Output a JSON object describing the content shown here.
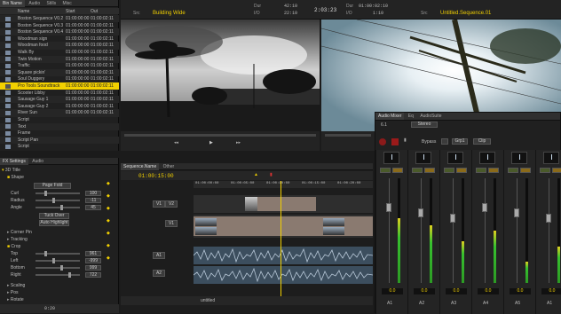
{
  "bin": {
    "tabs": [
      "Bin Name",
      "Audio",
      "Stills",
      "Misc"
    ],
    "columns": {
      "name": "Name",
      "in": "Start",
      "out": "Out"
    },
    "rows": [
      {
        "name": "Boston Sequence V0.2",
        "in": "01:00:00:00",
        "out": "01:00:02:11"
      },
      {
        "name": "Boston Sequence V0.3",
        "in": "01:00:00:00",
        "out": "01:00:02:11"
      },
      {
        "name": "Boston Sequence V0.4",
        "in": "01:00:00:00",
        "out": "01:00:02:11"
      },
      {
        "name": "Woodman sign",
        "in": "01:00:00:00",
        "out": "01:00:02:11"
      },
      {
        "name": "Woodman food",
        "in": "01:00:00:00",
        "out": "01:00:02:11"
      },
      {
        "name": "Walk By",
        "in": "01:00:00:00",
        "out": "01:00:02:11"
      },
      {
        "name": "Twin Motion",
        "in": "01:00:00:00",
        "out": "01:00:02:11"
      },
      {
        "name": "Traffic",
        "in": "01:00:00:00",
        "out": "01:00:02:11"
      },
      {
        "name": "Square pickin'",
        "in": "01:00:00:00",
        "out": "01:00:02:11"
      },
      {
        "name": "Soul Duggery",
        "in": "01:00:00:00",
        "out": "01:00:02:11"
      },
      {
        "name": "Pro Tools Soundtrack",
        "in": "01:00:00:00",
        "out": "01:00:02:11"
      },
      {
        "name": "Scooter Libby",
        "in": "01:00:00:00",
        "out": "01:00:02:11"
      },
      {
        "name": "Sausage Guy 1",
        "in": "01:00:00:00",
        "out": "01:00:02:11"
      },
      {
        "name": "Sausage Guy 2",
        "in": "01:00:00:00",
        "out": "01:00:02:11"
      },
      {
        "name": "River Sun",
        "in": "01:00:00:00",
        "out": "01:00:02:11"
      },
      {
        "name": "Script",
        "in": "",
        "out": ""
      },
      {
        "name": "Text",
        "in": "",
        "out": ""
      },
      {
        "name": "Frame",
        "in": "",
        "out": ""
      },
      {
        "name": "Script Pan",
        "in": "",
        "out": ""
      },
      {
        "name": "Script",
        "in": "",
        "out": ""
      }
    ]
  },
  "fx": {
    "tabs": [
      "FX Settings",
      "Audio"
    ],
    "title": "3D Title",
    "group_shape": "Shape",
    "dropdown": "Page Fold",
    "params": [
      {
        "label": "Curl",
        "value": "100"
      },
      {
        "label": "Radius",
        "value": "-11"
      },
      {
        "label": "Angle",
        "value": "45"
      }
    ],
    "tuck_over": "Tuck Over",
    "auto_highlight": "Auto Highlight",
    "group_corner": "Corner Pin",
    "group_tracking": "Tracking",
    "group_crop": "Crop",
    "crop": [
      {
        "label": "Top",
        "value": "961"
      },
      {
        "label": "Left",
        "value": "-999"
      },
      {
        "label": "Bottom",
        "value": "999"
      },
      {
        "label": "Right",
        "value": "722"
      }
    ],
    "group_scaling": "Scaling",
    "group_pos": "Pos",
    "group_rotate": "Rotate",
    "timecode": "0:20"
  },
  "source": {
    "label": "Src",
    "clip": "Building Wide"
  },
  "record": {
    "label": "Src",
    "clip": "Untitled.Sequence.01"
  },
  "center": {
    "dur_label": "Dur",
    "dur": "42:10",
    "io_label": "I/O",
    "io": "22:10",
    "master": "2:03:23",
    "r_dur": "01:00:02:10",
    "r_io": "1:10"
  },
  "timeline": {
    "tabs": [
      "Sequence.Name",
      "Other"
    ],
    "timecode": "01:00:15:00",
    "ruler": [
      "01:00:00:00",
      "01:00:05:00",
      "01:00:10:00",
      "01:00:15:00",
      "01:00:20:00"
    ],
    "tracks": [
      "V1",
      "V2",
      "V1",
      "A1",
      "A2"
    ],
    "bottom_label": "untitled"
  },
  "mixer": {
    "tabs": [
      "Audio Mixer",
      "Eq",
      "AudioSuite"
    ],
    "bypass": "Bypass",
    "group": "Grp1",
    "clip": "Clip",
    "stereo": "Stereo",
    "slot": "6.1",
    "channels": [
      {
        "name": "A1",
        "value": "0.0",
        "level": 0.62
      },
      {
        "name": "A2",
        "value": "0.0",
        "level": 0.55
      },
      {
        "name": "A3",
        "value": "0.0",
        "level": 0.4
      },
      {
        "name": "A4",
        "value": "0.0",
        "level": 0.5
      },
      {
        "name": "A5",
        "value": "0.0",
        "level": 0.2
      },
      {
        "name": "A1",
        "value": "0.0",
        "level": 0.35
      }
    ]
  }
}
